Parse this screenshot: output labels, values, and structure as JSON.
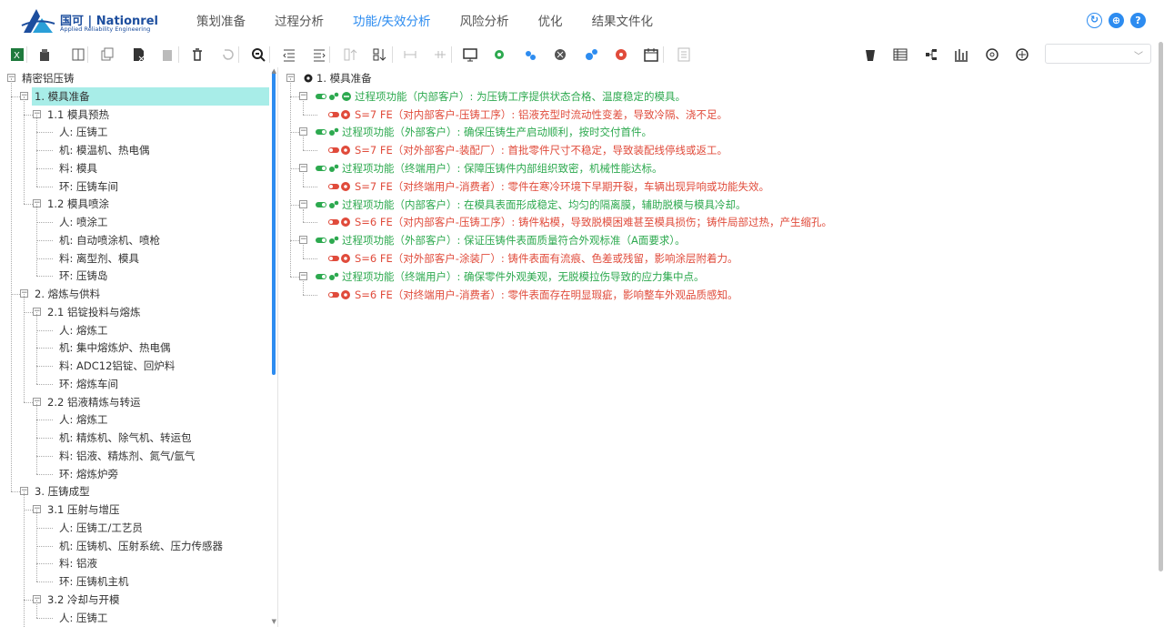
{
  "header": {
    "logo_title": "国可 | Nationrel",
    "logo_sub": "Applied Reliability Engineering",
    "nav": [
      {
        "label": "策划准备",
        "active": false
      },
      {
        "label": "过程分析",
        "active": false
      },
      {
        "label": "功能/失效分析",
        "active": true
      },
      {
        "label": "风险分析",
        "active": false
      },
      {
        "label": "优化",
        "active": false
      },
      {
        "label": "结果文件化",
        "active": false
      }
    ],
    "icons": [
      "refresh-icon",
      "globe-icon",
      "help-icon"
    ],
    "help_glyph": "?"
  },
  "toolbar": {
    "select_value": ""
  },
  "left_tree": [
    {
      "label": "精密铝压铸",
      "level": 0
    },
    {
      "label": "1. 模具准备",
      "level": 1,
      "selected": true
    },
    {
      "label": "1.1 模具预热",
      "level": 2
    },
    {
      "label": "人: 压铸工",
      "level": 3
    },
    {
      "label": "机: 模温机、热电偶",
      "level": 3
    },
    {
      "label": "料: 模具",
      "level": 3
    },
    {
      "label": "环: 压铸车间",
      "level": 3
    },
    {
      "label": "1.2 模具喷涂",
      "level": 2
    },
    {
      "label": "人: 喷涂工",
      "level": 3
    },
    {
      "label": "机: 自动喷涂机、喷枪",
      "level": 3
    },
    {
      "label": "料: 离型剂、模具",
      "level": 3
    },
    {
      "label": "环: 压铸岛",
      "level": 3
    },
    {
      "label": "2. 熔炼与供料",
      "level": 1
    },
    {
      "label": "2.1 铝锭投料与熔炼",
      "level": 2
    },
    {
      "label": "人: 熔炼工",
      "level": 3
    },
    {
      "label": "机: 集中熔炼炉、热电偶",
      "level": 3
    },
    {
      "label": "料: ADC12铝锭、回炉料",
      "level": 3
    },
    {
      "label": "环: 熔炼车间",
      "level": 3
    },
    {
      "label": "2.2 铝液精炼与转运",
      "level": 2
    },
    {
      "label": "人: 熔炼工",
      "level": 3
    },
    {
      "label": "机: 精炼机、除气机、转运包",
      "level": 3
    },
    {
      "label": "料: 铝液、精炼剂、氮气/氩气",
      "level": 3
    },
    {
      "label": "环: 熔炼炉旁",
      "level": 3
    },
    {
      "label": "3. 压铸成型",
      "level": 1
    },
    {
      "label": "3.1 压射与增压",
      "level": 2
    },
    {
      "label": "人: 压铸工/工艺员",
      "level": 3
    },
    {
      "label": "机: 压铸机、压射系统、压力传感器",
      "level": 3
    },
    {
      "label": "料: 铝液",
      "level": 3
    },
    {
      "label": "环: 压铸机主机",
      "level": 3
    },
    {
      "label": "3.2 冷却与开模",
      "level": 2
    },
    {
      "label": "人: 压铸工",
      "level": 3
    }
  ],
  "right_tree": {
    "root": "1. 模具准备",
    "items": [
      {
        "kind": "function",
        "text": "过程项功能（内部客户）: 为压铸工序提供状态合格、温度稳定的模具。"
      },
      {
        "kind": "failure",
        "text": "S=7 FE（对内部客户-压铸工序）: 铝液充型时流动性变差，导致冷隔、浇不足。"
      },
      {
        "kind": "function",
        "text": "过程项功能（外部客户）: 确保压铸生产启动顺利，按时交付首件。"
      },
      {
        "kind": "failure",
        "text": "S=7 FE（对外部客户-装配厂）: 首批零件尺寸不稳定，导致装配线停线或返工。"
      },
      {
        "kind": "function",
        "text": "过程项功能（终端用户）: 保障压铸件内部组织致密，机械性能达标。"
      },
      {
        "kind": "failure",
        "text": "S=7 FE（对终端用户-消费者）: 零件在寒冷环境下早期开裂，车辆出现异响或功能失效。"
      },
      {
        "kind": "function",
        "text": "过程项功能（内部客户）: 在模具表面形成稳定、均匀的隔离膜，辅助脱模与模具冷却。"
      },
      {
        "kind": "failure",
        "text": "S=6 FE（对内部客户-压铸工序）: 铸件粘模，导致脱模困难甚至模具损伤；铸件局部过热，产生缩孔。"
      },
      {
        "kind": "function",
        "text": "过程项功能（外部客户）: 保证压铸件表面质量符合外观标准（A面要求）。"
      },
      {
        "kind": "failure",
        "text": "S=6 FE（对外部客户-涂装厂）: 铸件表面有流痕、色差或残留，影响涂层附着力。"
      },
      {
        "kind": "function",
        "text": "过程项功能（终端用户）: 确保零件外观美观，无脱模拉伤导致的应力集中点。"
      },
      {
        "kind": "failure",
        "text": "S=6 FE（对终端用户-消费者）: 零件表面存在明显瑕疵，影响整车外观品质感知。"
      }
    ]
  },
  "colors": {
    "accent": "#2d8cf0",
    "selected_bg": "#a8ede8",
    "function_green": "#2da94f",
    "failure_red": "#e04b3b"
  }
}
